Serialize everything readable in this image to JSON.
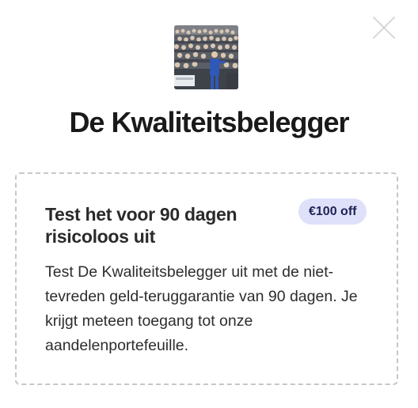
{
  "dialog": {
    "close_icon": "close-icon",
    "publication_title": "De Kwaliteitsbelegger"
  },
  "offer": {
    "heading": "Test het voor 90 dagen risicoloos uit",
    "badge": "€100 off",
    "description": "Test De Kwaliteitsbelegger uit met de niet-tevreden geld-teruggarantie van 90 dagen. Je krijgt meteen toegang tot onze aandelenportefeuille.",
    "badge_background": "#dfe1fb",
    "badge_text_color": "#1e2354",
    "border_color": "#c7c7c7"
  }
}
